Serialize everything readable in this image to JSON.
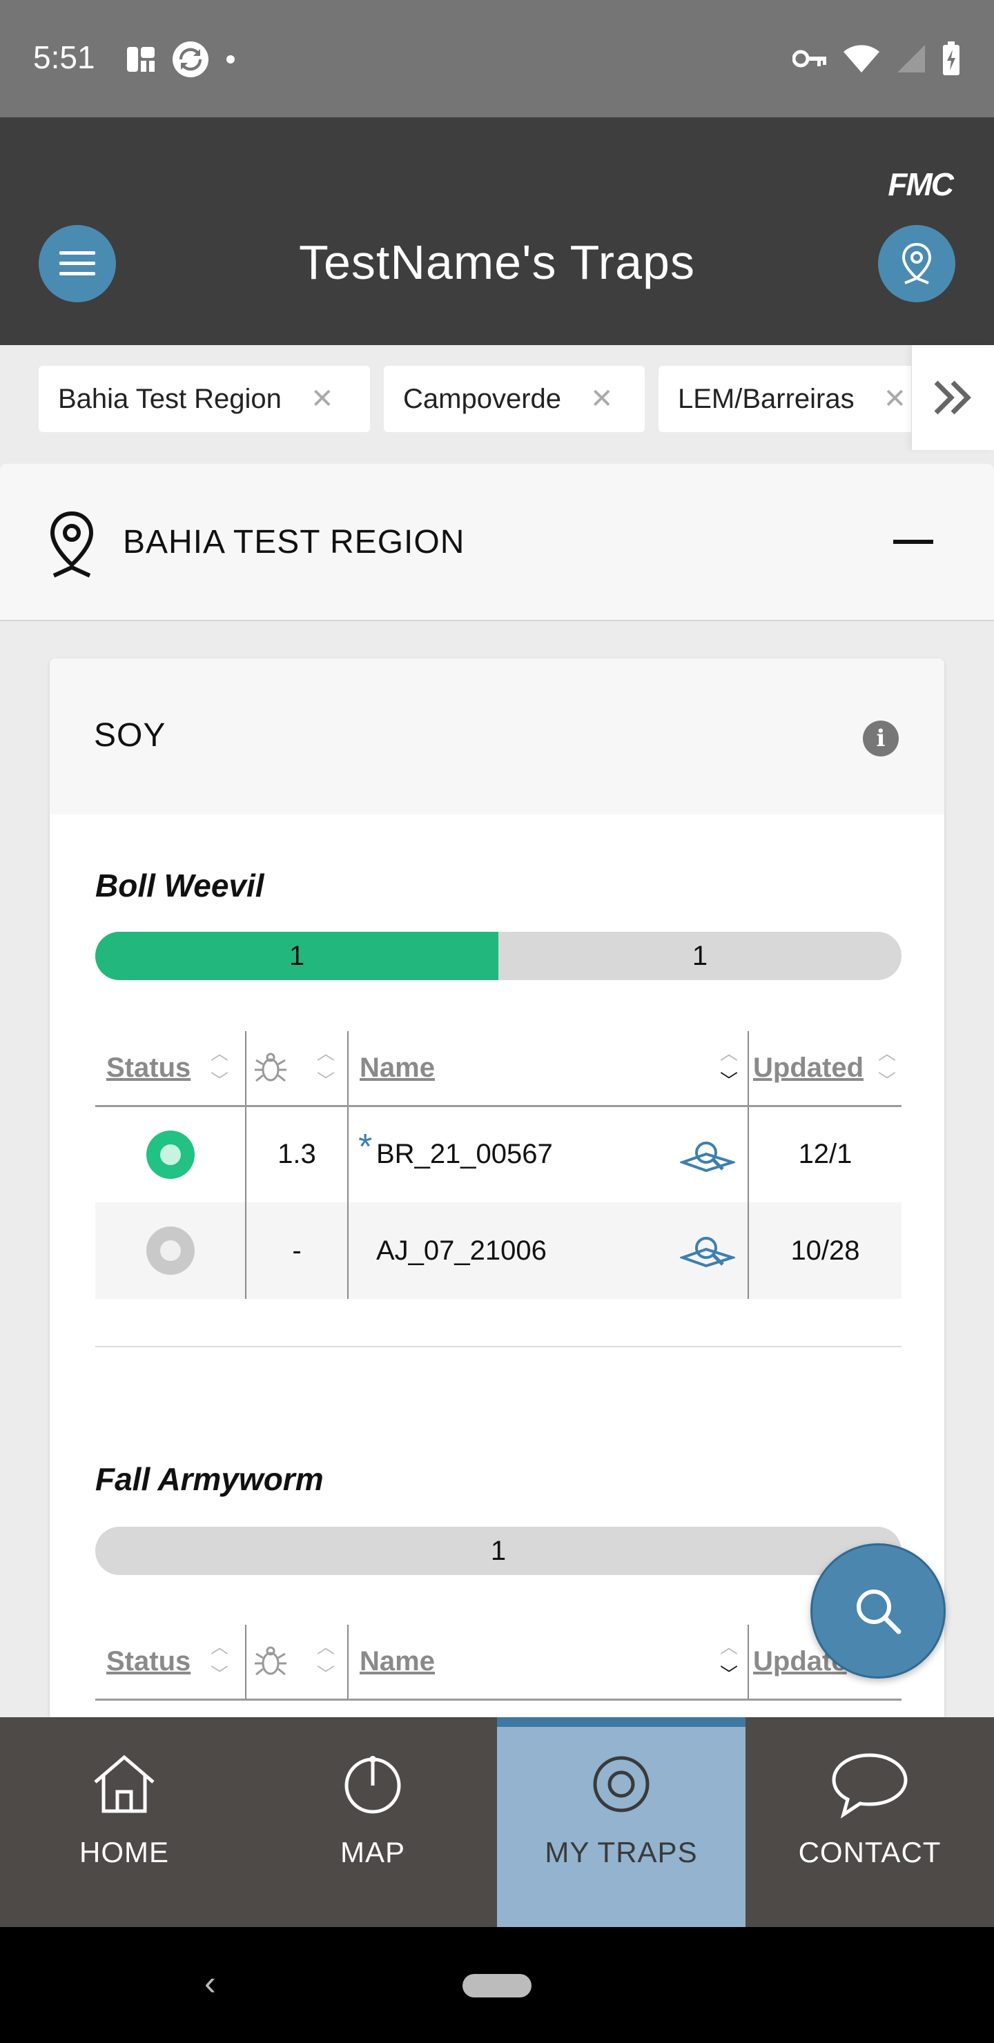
{
  "status_bar": {
    "time": "5:51"
  },
  "header": {
    "brand": "FMC",
    "title": "TestName's Traps"
  },
  "chips": [
    {
      "label": "Bahia Test Region"
    },
    {
      "label": "Campoverde"
    },
    {
      "label": "LEM/Barreiras"
    }
  ],
  "region": {
    "name": "BAHIA TEST REGION"
  },
  "card": {
    "crop": "SOY",
    "info_glyph": "i",
    "columns": {
      "status": "Status",
      "name": "Name",
      "updated": "Updated",
      "updated_truncated": "Update"
    },
    "pests": [
      {
        "name": "Boll Weevil",
        "bar": [
          {
            "count": "1",
            "share": 0.5,
            "color": "#22b87d"
          },
          {
            "count": "1",
            "share": 0.5,
            "color": "#d8d8d8"
          }
        ],
        "rows": [
          {
            "status": "active",
            "count": "1.3",
            "flag": "*",
            "name": "BR_21_00567",
            "updated": "12/1"
          },
          {
            "status": "inactive",
            "count": "-",
            "flag": "",
            "name": "AJ_07_21006",
            "updated": "10/28"
          }
        ]
      },
      {
        "name": "Fall Armyworm",
        "bar": [
          {
            "count": "1",
            "share": 1.0,
            "color": "#d8d8d8"
          }
        ],
        "rows": []
      }
    ]
  },
  "bottom_nav": [
    {
      "label": "HOME",
      "icon": "home-icon",
      "active": false
    },
    {
      "label": "MAP",
      "icon": "map-icon",
      "active": false
    },
    {
      "label": "MY TRAPS",
      "icon": "target-icon",
      "active": true
    },
    {
      "label": "CONTACT",
      "icon": "chat-icon",
      "active": false
    }
  ],
  "colors": {
    "header_bg": "#3e3e3e",
    "accent_blue": "#4a8bb2",
    "status_green": "#22b87d",
    "nav_active": "#93b3cf"
  }
}
